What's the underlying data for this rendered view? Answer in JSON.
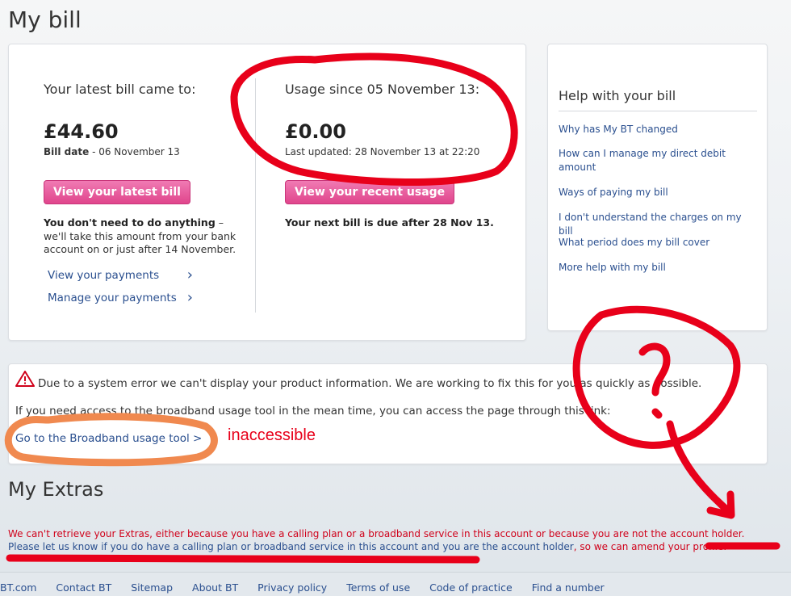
{
  "page": {
    "title": "My bill"
  },
  "bill": {
    "latest_heading": "Your latest bill came to:",
    "latest_amount": "£44.60",
    "bill_date_label": "Bill date",
    "bill_date_value": "- 06 November 13",
    "view_latest_button": "View your latest bill",
    "notice_bold": "You don't need to do anything",
    "notice_rest": " – we'll take this amount from your bank account on or just after 14 November.",
    "links": [
      {
        "label": "View your payments"
      },
      {
        "label": "Manage your payments"
      }
    ],
    "usage_heading": "Usage since 05 November 13:",
    "usage_amount": "£0.00",
    "last_updated": "Last updated: 28 November 13 at 22:20",
    "view_usage_button": "View your recent usage",
    "next_bill": "Your next bill is due after 28 Nov 13."
  },
  "help": {
    "title": "Help with your bill",
    "links": [
      "Why has My BT changed",
      "How can I manage my direct debit amount",
      "Ways of paying my bill",
      "I don't understand the charges on my bill",
      "What period does my bill cover",
      "More help with my bill"
    ]
  },
  "error": {
    "line1": "Due to a system error we can't display your product information. We are working to fix this for you as quickly as possible.",
    "line2": "If you need access to the broadband usage tool in the mean time, you can access the page through this link:",
    "link": "Go to the Broadband usage tool >"
  },
  "annotations": {
    "label": "inaccessible",
    "color": "#e8001a",
    "orange": "#f0894f"
  },
  "extras": {
    "title": "My Extras",
    "message": "We can't retrieve your Extras, either because you have a calling plan or a broadband service in this account or because you are not the account holder.",
    "link": "Please let us know if you do have a calling plan or broadband service in this account and you are the account holder",
    "suffix": ", so we can amend your profile."
  },
  "footer": {
    "links": [
      "BT.com",
      "Contact BT",
      "Sitemap",
      "About BT",
      "Privacy policy",
      "Terms of use",
      "Code of practice",
      "Find a number"
    ]
  }
}
